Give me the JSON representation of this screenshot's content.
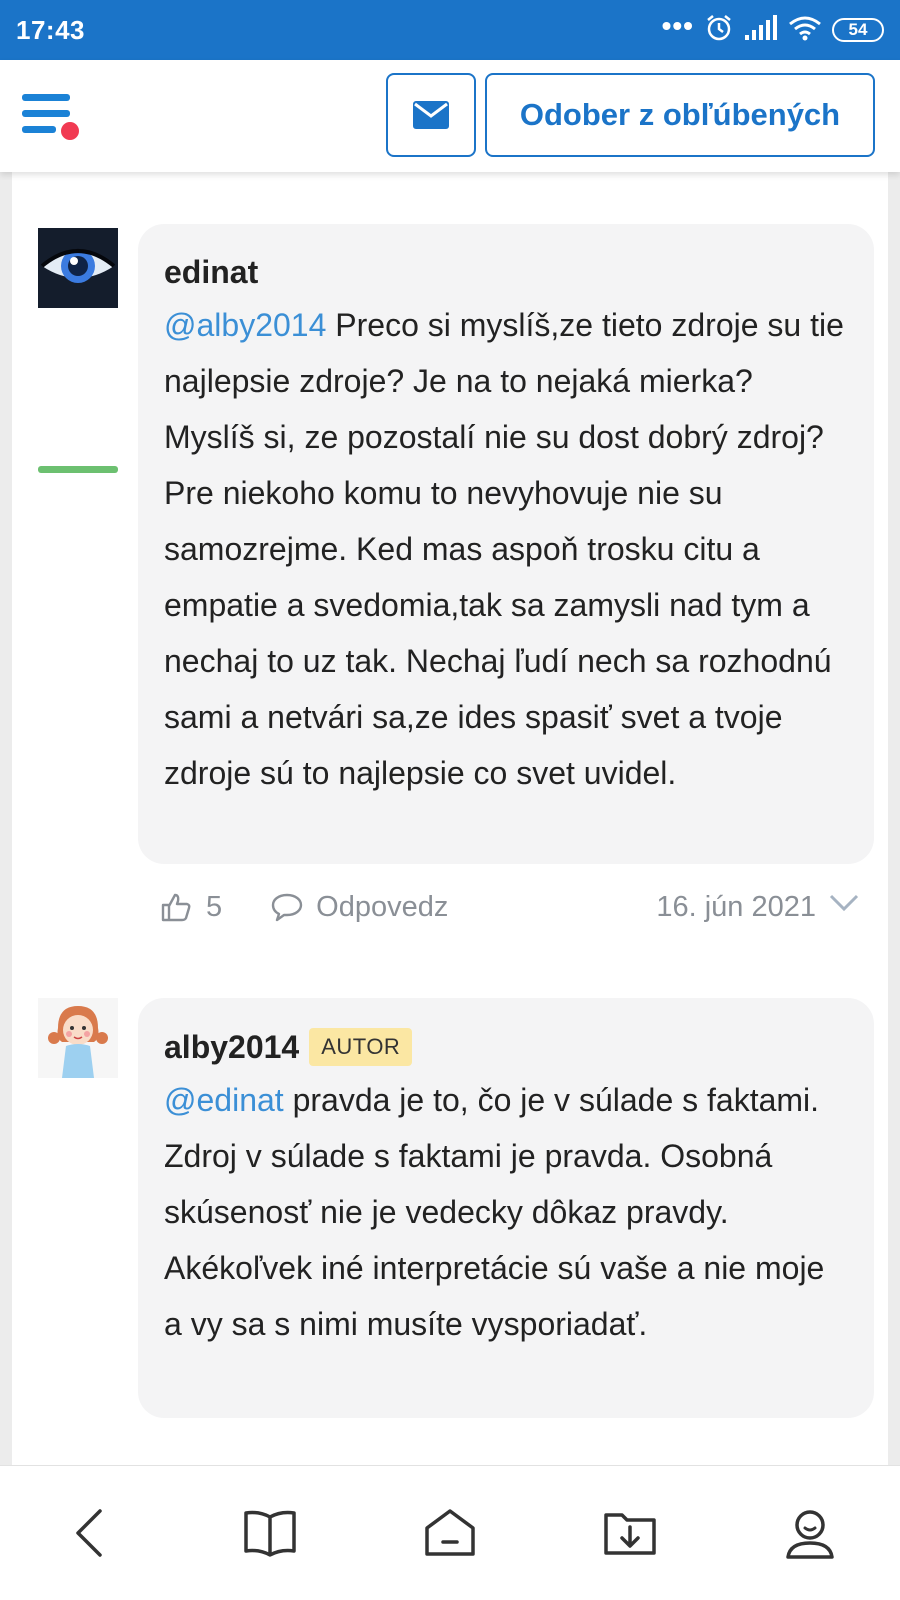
{
  "status_bar": {
    "time": "17:43",
    "battery": "54",
    "icons": [
      "more-dots-icon",
      "alarm-icon",
      "signal-icon",
      "wifi-icon",
      "battery-icon"
    ]
  },
  "header": {
    "menu_icon": "hamburger-menu-icon",
    "has_notification": true,
    "mail_icon": "envelope-icon",
    "favorite_button_label": "Odober z obľúbených"
  },
  "colors": {
    "accent": "#1b74c8",
    "mention": "#3b8fd6",
    "notification": "#f13a52",
    "badge_bg": "#fbe7a3",
    "bubble_bg": "#f4f4f5",
    "meta_text": "#8a8f96"
  },
  "comments": [
    {
      "author": "edinat",
      "mention": "@alby2014",
      "text": " Preco si myslíš,ze tieto zdroje su tie najlepsie zdroje? Je na to nejaká mierka? Myslíš si, ze pozostalí nie su dost dobrý zdroj? Pre niekoho komu to nevyhovuje nie su samozrejme. Ked mas aspoň trosku citu a empatie a svedomia,tak sa zamysli nad tym a nechaj to uz tak. Nechaj ľudí nech sa rozhodnú sami a netvári sa,ze ides spasiť svet a tvoje zdroje sú to najlepsie co svet uvidel.",
      "likes": "5",
      "reply_label": "Odpovedz",
      "date": "16. jún 2021"
    },
    {
      "author": "alby2014",
      "badge": "AUTOR",
      "mention": "@edinat",
      "text": " pravda je to, čo je v súlade s faktami. Zdroj v súlade s faktami je pravda. Osobná skúsenosť nie je vedecky dôkaz pravdy. Akékoľvek iné interpretácie sú vaše a nie moje a vy sa s nimi musíte vysporiadať."
    }
  ],
  "bottom_nav": [
    "back-icon",
    "book-icon",
    "home-icon",
    "download-folder-icon",
    "profile-icon"
  ]
}
